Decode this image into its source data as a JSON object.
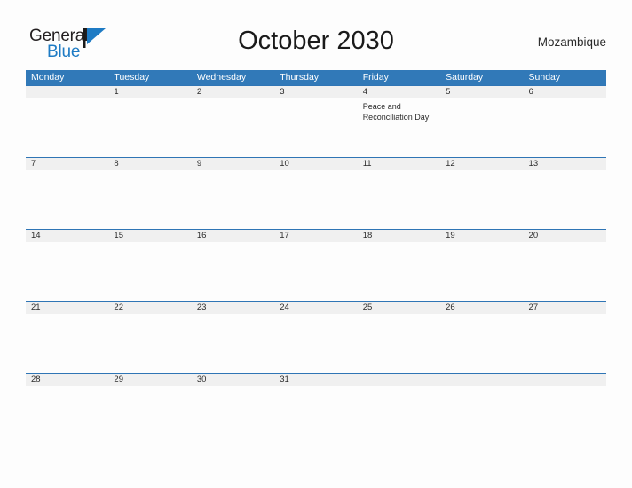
{
  "brand": {
    "name_part1": "General",
    "name_part2": "Blue",
    "logo_icon": "triangle-flag-mark"
  },
  "header": {
    "title": "October 2030",
    "country": "Mozambique"
  },
  "calendar": {
    "weekdays": [
      "Monday",
      "Tuesday",
      "Wednesday",
      "Thursday",
      "Friday",
      "Saturday",
      "Sunday"
    ],
    "weeks": [
      [
        {
          "day": "",
          "event": ""
        },
        {
          "day": "1",
          "event": ""
        },
        {
          "day": "2",
          "event": ""
        },
        {
          "day": "3",
          "event": ""
        },
        {
          "day": "4",
          "event": "Peace and Reconciliation Day"
        },
        {
          "day": "5",
          "event": ""
        },
        {
          "day": "6",
          "event": ""
        }
      ],
      [
        {
          "day": "7",
          "event": ""
        },
        {
          "day": "8",
          "event": ""
        },
        {
          "day": "9",
          "event": ""
        },
        {
          "day": "10",
          "event": ""
        },
        {
          "day": "11",
          "event": ""
        },
        {
          "day": "12",
          "event": ""
        },
        {
          "day": "13",
          "event": ""
        }
      ],
      [
        {
          "day": "14",
          "event": ""
        },
        {
          "day": "15",
          "event": ""
        },
        {
          "day": "16",
          "event": ""
        },
        {
          "day": "17",
          "event": ""
        },
        {
          "day": "18",
          "event": ""
        },
        {
          "day": "19",
          "event": ""
        },
        {
          "day": "20",
          "event": ""
        }
      ],
      [
        {
          "day": "21",
          "event": ""
        },
        {
          "day": "22",
          "event": ""
        },
        {
          "day": "23",
          "event": ""
        },
        {
          "day": "24",
          "event": ""
        },
        {
          "day": "25",
          "event": ""
        },
        {
          "day": "26",
          "event": ""
        },
        {
          "day": "27",
          "event": ""
        }
      ],
      [
        {
          "day": "28",
          "event": ""
        },
        {
          "day": "29",
          "event": ""
        },
        {
          "day": "30",
          "event": ""
        },
        {
          "day": "31",
          "event": ""
        },
        {
          "day": "",
          "event": ""
        },
        {
          "day": "",
          "event": ""
        },
        {
          "day": "",
          "event": ""
        }
      ]
    ]
  },
  "colors": {
    "header_blue": "#3179b8",
    "row_divider_blue": "#2f75b5",
    "day_band_gray": "#f0f0f0",
    "logo_blue": "#1e7bc4",
    "page_background": "#fdfdfd"
  }
}
